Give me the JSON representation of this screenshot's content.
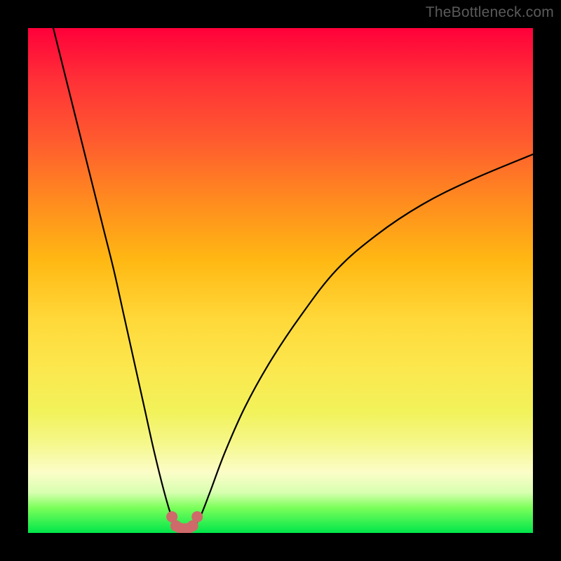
{
  "watermark": {
    "text": "TheBottleneck.com"
  },
  "colors": {
    "frame": "#000000",
    "curve_stroke": "#000000",
    "marker_fill": "#cf6a6a",
    "marker_stroke": "#cf6a6a"
  },
  "chart_data": {
    "type": "line",
    "title": "",
    "xlabel": "",
    "ylabel": "",
    "xlim": [
      0,
      100
    ],
    "ylim": [
      0,
      100
    ],
    "grid": false,
    "legend": false,
    "series": [
      {
        "name": "curve-left",
        "x": [
          5,
          7,
          9,
          11,
          13,
          15,
          17,
          19,
          21,
          23,
          25,
          27,
          28.5,
          29.5
        ],
        "y": [
          100,
          92,
          84,
          76,
          68,
          60,
          52,
          43,
          34,
          25,
          16,
          8,
          3,
          1
        ]
      },
      {
        "name": "curve-right",
        "x": [
          32.5,
          34,
          36,
          39,
          43,
          48,
          54,
          61,
          69,
          78,
          88,
          100
        ],
        "y": [
          1,
          3,
          8,
          16,
          25,
          34,
          43,
          52,
          59,
          65,
          70,
          75
        ]
      },
      {
        "name": "valley-floor",
        "x": [
          29.5,
          30.5,
          31.5,
          32.5
        ],
        "y": [
          1,
          0.5,
          0.5,
          1
        ]
      }
    ],
    "markers": {
      "name": "highlight-dots",
      "x": [
        28.5,
        29.3,
        30.2,
        31.0,
        31.8,
        32.6,
        33.5
      ],
      "y": [
        3.2,
        1.4,
        0.9,
        0.8,
        0.9,
        1.4,
        3.2
      ],
      "size": 8
    }
  }
}
